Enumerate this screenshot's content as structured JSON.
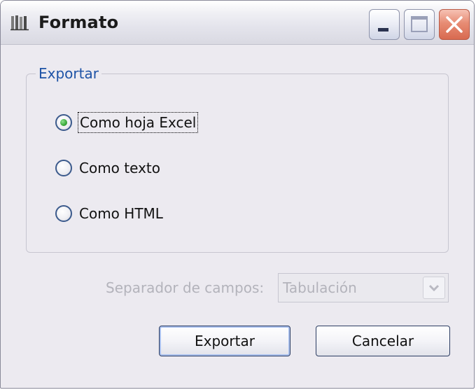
{
  "window": {
    "title": "Formato",
    "controls": {
      "minimize_icon": "minimize-icon",
      "maximize_icon": "maximize-icon",
      "close_icon": "close-icon"
    }
  },
  "export_group": {
    "legend": "Exportar",
    "options": [
      {
        "label": "Como hoja Excel",
        "selected": true
      },
      {
        "label": "Como texto",
        "selected": false
      },
      {
        "label": "Como HTML",
        "selected": false
      }
    ]
  },
  "separator": {
    "label": "Separador de campos:",
    "value": "Tabulación",
    "enabled": false
  },
  "buttons": {
    "export": "Exportar",
    "cancel": "Cancelar"
  },
  "colors": {
    "legend": "#1e53a6",
    "disabled_text": "#b3b3bb",
    "radio_selected": "#3fae3f",
    "close_button": "#d86a50"
  }
}
